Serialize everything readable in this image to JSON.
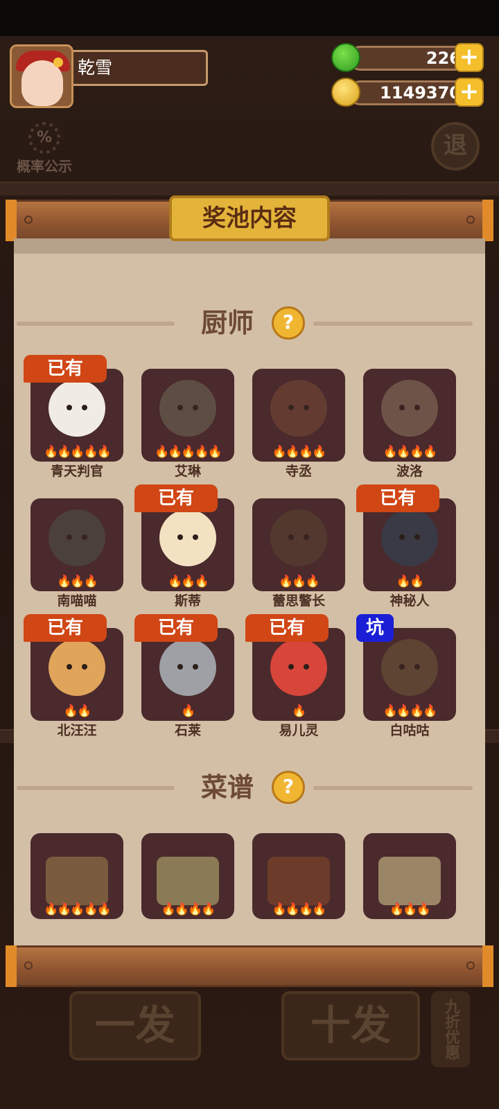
{
  "player": {
    "name": "乾雪"
  },
  "resources": {
    "apples": "226",
    "coins": "1149370",
    "add": "+"
  },
  "probability": {
    "icon_symbol": "%",
    "label": "概率公示"
  },
  "exit": {
    "label": "退"
  },
  "pool": {
    "title": "奖池内容",
    "help_symbol": "?",
    "owned_label": "已有",
    "pit_label": "坑",
    "chefs_section": "厨师",
    "recipes_section": "菜谱",
    "chefs": [
      {
        "name": "青天判官",
        "stars": "🔥🔥🔥🔥🔥",
        "color": "#f0ece4",
        "owned": true
      },
      {
        "name": "艾琳",
        "stars": "🔥🔥🔥🔥🔥",
        "color": "#6f6a57",
        "owned": false
      },
      {
        "name": "寺丞",
        "stars": "🔥🔥🔥🔥",
        "color": "#7a4a36",
        "owned": false
      },
      {
        "name": "波洛",
        "stars": "🔥🔥🔥🔥",
        "color": "#8c7760",
        "owned": false
      },
      {
        "name": "南喵喵",
        "stars": "🔥🔥🔥",
        "color": "#4c5248",
        "owned": false
      },
      {
        "name": "斯蒂",
        "stars": "🔥🔥🔥",
        "color": "#f3e2c2",
        "owned": true
      },
      {
        "name": "蕾思警长",
        "stars": "🔥🔥🔥",
        "color": "#5a4530",
        "owned": false
      },
      {
        "name": "神秘人",
        "stars": "🔥🔥",
        "color": "#3a3a46",
        "owned": true
      },
      {
        "name": "北汪汪",
        "stars": "🔥🔥",
        "color": "#e0a45a",
        "owned": true
      },
      {
        "name": "石莱",
        "stars": "🔥",
        "color": "#9ea0a6",
        "owned": true
      },
      {
        "name": "易儿灵",
        "stars": "🔥",
        "color": "#d8453a",
        "owned": true
      },
      {
        "name": "白咕咕",
        "stars": "🔥🔥🔥🔥",
        "color": "#6e5a3a",
        "owned": false,
        "pit": true
      }
    ],
    "recipes": [
      {
        "stars": "🔥🔥🔥🔥🔥",
        "color": "#7a5b3d"
      },
      {
        "stars": "🔥🔥🔥🔥",
        "color": "#8a7a55"
      },
      {
        "stars": "🔥🔥🔥🔥",
        "color": "#6d3b2a"
      },
      {
        "stars": "🔥🔥🔥",
        "color": "#9a8566"
      }
    ]
  },
  "bottom_buttons": {
    "single": "一发",
    "ten": "十发",
    "discount": "九折优惠"
  }
}
